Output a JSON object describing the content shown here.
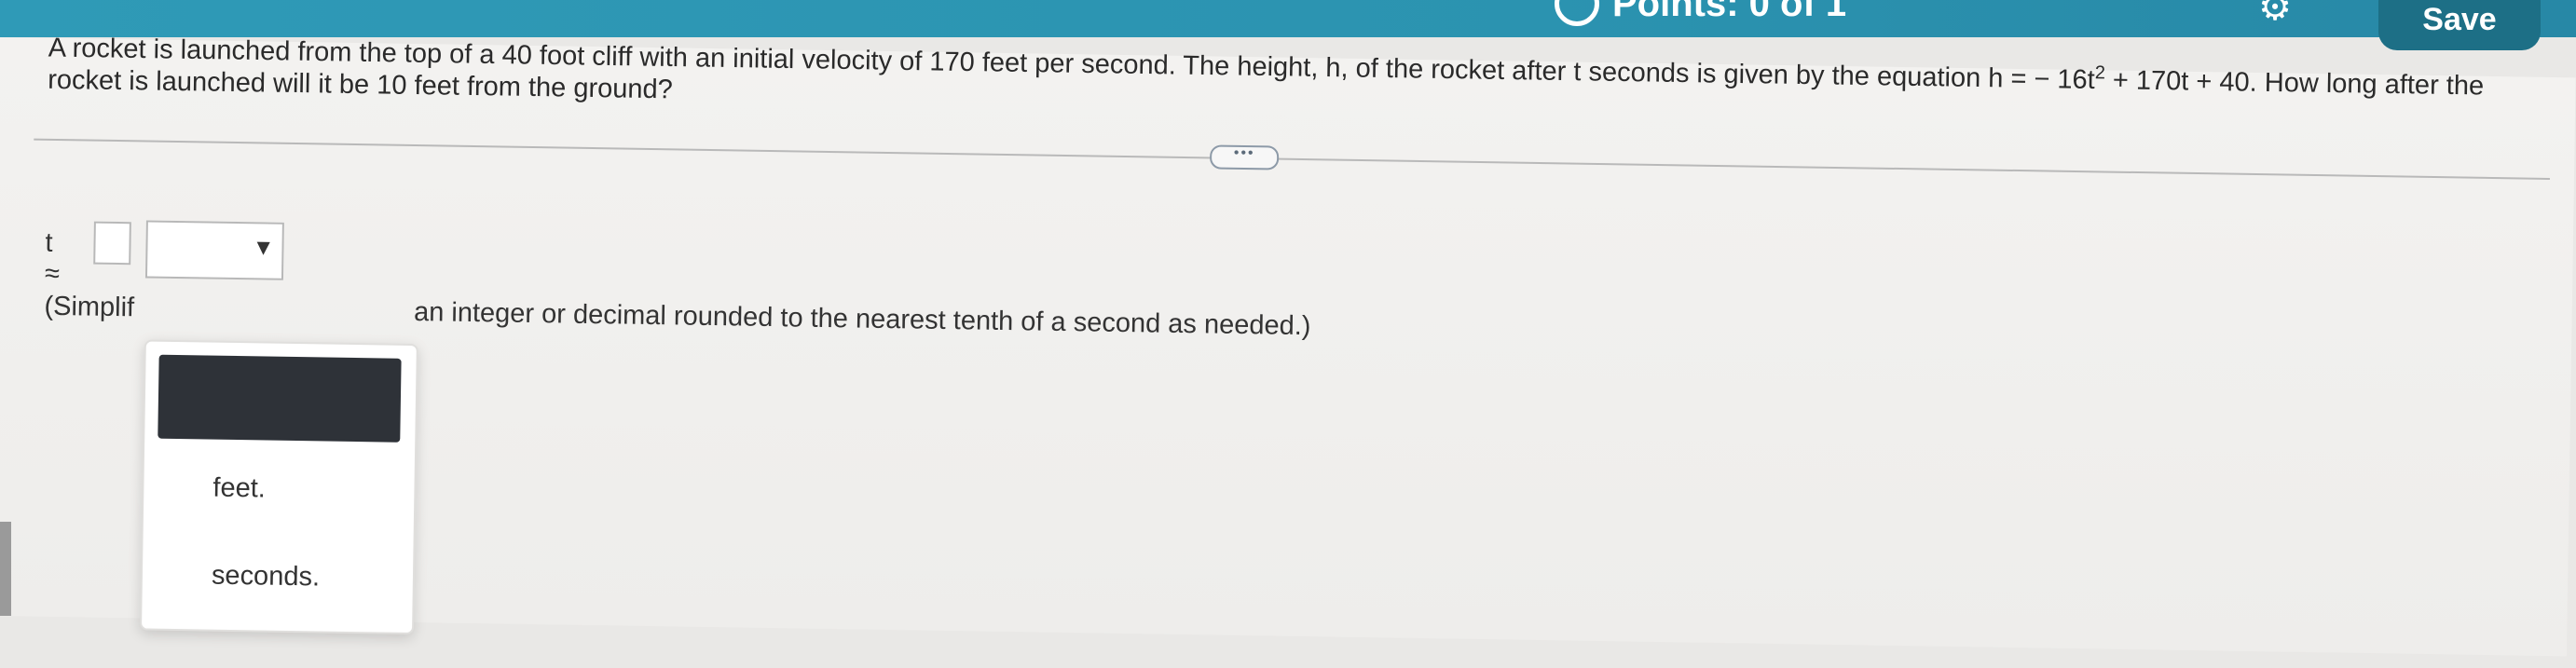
{
  "header": {
    "points_label": "Points: 0 of 1",
    "gear_icon": "gear-icon",
    "save_label": "Save",
    "accent_color": "#2f9ab7"
  },
  "question": {
    "text_part1": "A rocket is launched from the top of a 40 foot cliff with an initial velocity of 170 feet per second. The height, h, of the rocket after t seconds is given by the equation h = − 16t",
    "exponent": "2",
    "text_part2": " + 170t + 40. How long after the rocket is launched will it be 10 feet from the ground?"
  },
  "expand_button": "•••",
  "answer": {
    "variable_label": "t ≈",
    "input_value": "",
    "unit_selected": "",
    "arrow_icon": "▼"
  },
  "instructions": {
    "prefix": "(Simplif",
    "suffix": "an integer or decimal rounded to the nearest tenth of a second as needed.)"
  },
  "dropdown": {
    "options": [
      "",
      "feet.",
      "seconds."
    ]
  }
}
